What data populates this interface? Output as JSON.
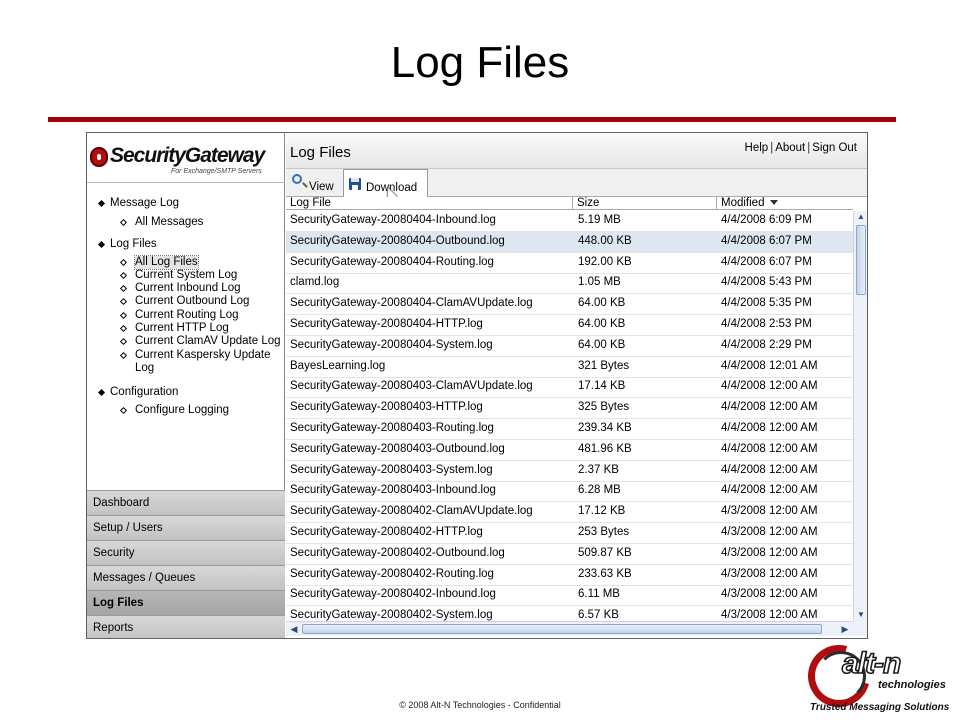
{
  "slide": {
    "title": "Log Files",
    "footer": "© 2008 Alt-N Technologies - Confidential",
    "accent_color": "#a8000a"
  },
  "sidebar": {
    "brand": "SecurityGateway",
    "brand_tagline": "For Exchange/SMTP Servers",
    "tree": [
      {
        "label": "Message Log",
        "children": [
          "All Messages"
        ]
      },
      {
        "label": "Log Files",
        "children": [
          "All Log Files",
          "Current System Log",
          "Current Inbound Log",
          "Current Outbound Log",
          "Current Routing Log",
          "Current HTTP Log",
          "Current ClamAV Update Log",
          "Current Kaspersky Update",
          "Log"
        ]
      },
      {
        "label": "Configuration",
        "children": [
          "Configure Logging"
        ]
      }
    ],
    "selected_item": "All Log Files",
    "nav": [
      "Dashboard",
      "Setup / Users",
      "Security",
      "Messages / Queues",
      "Log Files",
      "Reports"
    ],
    "active_nav": "Log Files"
  },
  "header": {
    "title": "Log Files",
    "links": [
      "Help",
      "About",
      "Sign Out"
    ],
    "separator": "|"
  },
  "toolbar": {
    "view_label": "View",
    "view_icon": "magnifier-icon",
    "download_label": "Download",
    "download_icon": "floppy-disk-icon"
  },
  "table": {
    "columns": [
      "Log File",
      "Size",
      "Modified"
    ],
    "sorted_column": "Modified",
    "sort_direction": "descending",
    "highlighted_row": 1,
    "rows": [
      [
        "SecurityGateway-20080404-Inbound.log",
        "5.19 MB",
        "4/4/2008 6:09 PM"
      ],
      [
        "SecurityGateway-20080404-Outbound.log",
        "448.00 KB",
        "4/4/2008 6:07 PM"
      ],
      [
        "SecurityGateway-20080404-Routing.log",
        "192.00 KB",
        "4/4/2008 6:07 PM"
      ],
      [
        "clamd.log",
        "1.05 MB",
        "4/4/2008 5:43 PM"
      ],
      [
        "SecurityGateway-20080404-ClamAVUpdate.log",
        "64.00 KB",
        "4/4/2008 5:35 PM"
      ],
      [
        "SecurityGateway-20080404-HTTP.log",
        "64.00 KB",
        "4/4/2008 2:53 PM"
      ],
      [
        "SecurityGateway-20080404-System.log",
        "64.00 KB",
        "4/4/2008 2:29 PM"
      ],
      [
        "BayesLearning.log",
        "321 Bytes",
        "4/4/2008 12:01 AM"
      ],
      [
        "SecurityGateway-20080403-ClamAVUpdate.log",
        "17.14 KB",
        "4/4/2008 12:00 AM"
      ],
      [
        "SecurityGateway-20080403-HTTP.log",
        "325 Bytes",
        "4/4/2008 12:00 AM"
      ],
      [
        "SecurityGateway-20080403-Routing.log",
        "239.34 KB",
        "4/4/2008 12:00 AM"
      ],
      [
        "SecurityGateway-20080403-Outbound.log",
        "481.96 KB",
        "4/4/2008 12:00 AM"
      ],
      [
        "SecurityGateway-20080403-System.log",
        "2.37 KB",
        "4/4/2008 12:00 AM"
      ],
      [
        "SecurityGateway-20080403-Inbound.log",
        "6.28 MB",
        "4/4/2008 12:00 AM"
      ],
      [
        "SecurityGateway-20080402-ClamAVUpdate.log",
        "17.12 KB",
        "4/3/2008 12:00 AM"
      ],
      [
        "SecurityGateway-20080402-HTTP.log",
        "253 Bytes",
        "4/3/2008 12:00 AM"
      ],
      [
        "SecurityGateway-20080402-Outbound.log",
        "509.87 KB",
        "4/3/2008 12:00 AM"
      ],
      [
        "SecurityGateway-20080402-Routing.log",
        "233.63 KB",
        "4/3/2008 12:00 AM"
      ],
      [
        "SecurityGateway-20080402-Inbound.log",
        "6.11 MB",
        "4/3/2008 12:00 AM"
      ],
      [
        "SecurityGateway-20080402-System.log",
        "6.57 KB",
        "4/3/2008 12:00 AM"
      ]
    ]
  },
  "company_logo": {
    "name": "alt-n",
    "subtitle": "technologies",
    "slogan": "Trusted Messaging Solutions",
    "brand_color": "#b00d10"
  }
}
